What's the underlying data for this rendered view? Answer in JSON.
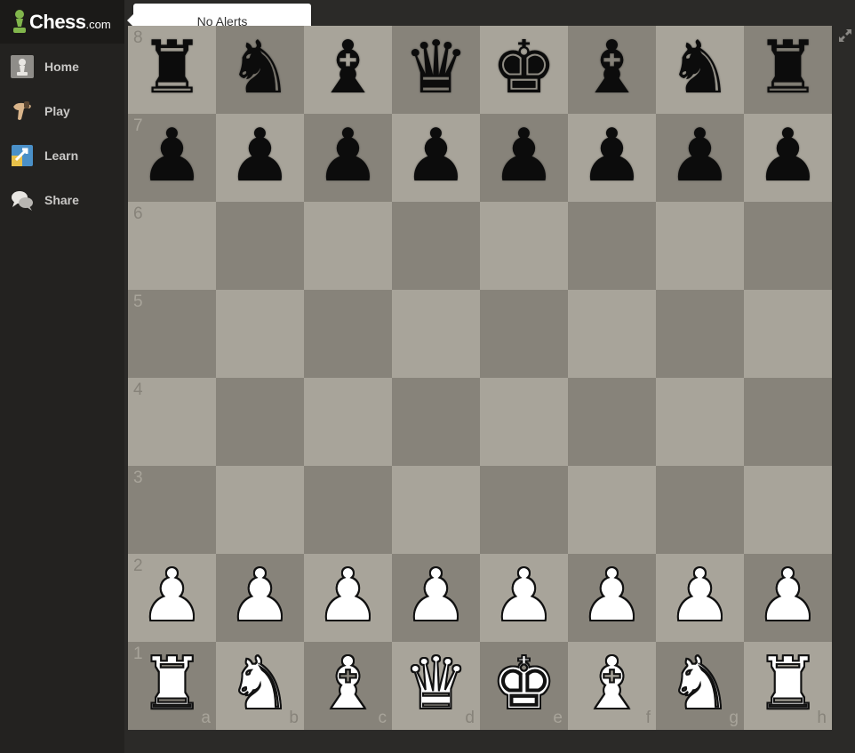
{
  "logo": {
    "name": "Chess",
    "suffix": ".com"
  },
  "nav": {
    "items": [
      {
        "label": "Home",
        "icon": "home-pawn-icon"
      },
      {
        "label": "Play",
        "icon": "play-hand-icon"
      },
      {
        "label": "Learn",
        "icon": "learn-board-icon"
      },
      {
        "label": "Share",
        "icon": "share-chat-icon"
      }
    ]
  },
  "alerts": {
    "text": "No Alerts"
  },
  "board": {
    "files": [
      "a",
      "b",
      "c",
      "d",
      "e",
      "f",
      "g",
      "h"
    ],
    "ranks": [
      "8",
      "7",
      "6",
      "5",
      "4",
      "3",
      "2",
      "1"
    ],
    "light_color": "#a8a49a",
    "dark_color": "#87837a",
    "position": [
      [
        "bR",
        "bN",
        "bB",
        "bQ",
        "bK",
        "bB",
        "bN",
        "bR"
      ],
      [
        "bP",
        "bP",
        "bP",
        "bP",
        "bP",
        "bP",
        "bP",
        "bP"
      ],
      [
        "",
        "",
        "",
        "",
        "",
        "",
        "",
        ""
      ],
      [
        "",
        "",
        "",
        "",
        "",
        "",
        "",
        ""
      ],
      [
        "",
        "",
        "",
        "",
        "",
        "",
        "",
        ""
      ],
      [
        "",
        "",
        "",
        "",
        "",
        "",
        "",
        ""
      ],
      [
        "wP",
        "wP",
        "wP",
        "wP",
        "wP",
        "wP",
        "wP",
        "wP"
      ],
      [
        "wR",
        "wN",
        "wB",
        "wQ",
        "wK",
        "wB",
        "wN",
        "wR"
      ]
    ]
  },
  "colors": {
    "sidebar": "#232220",
    "logo_bar": "#1b1a18",
    "background": "#2b2a28"
  }
}
